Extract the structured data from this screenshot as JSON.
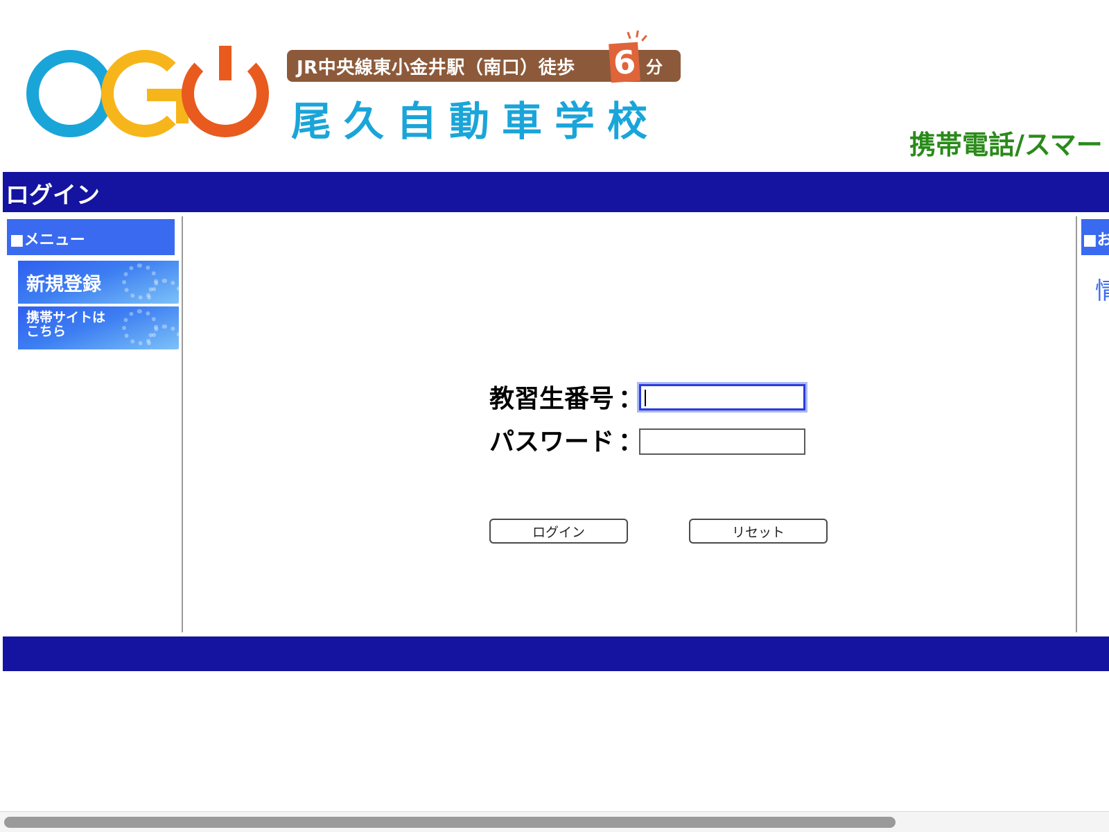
{
  "header": {
    "logo_alt": "OGO",
    "access": "JR中央線東小金井駅（南口）徒歩",
    "access_minutes": "6",
    "access_unit": "分",
    "school_name": "尾久自動車学校",
    "mobile_banner": "携帯電話/スマートフ"
  },
  "title": "ログイン",
  "sidebar": {
    "heading": "■メニュー",
    "items": [
      {
        "label": "新規登録"
      },
      {
        "label_lines": [
          "携帯サイトは",
          "こちら"
        ]
      }
    ]
  },
  "form": {
    "student_label": "教習生番号",
    "password_label": "パスワード",
    "colon": "：",
    "student_value": "",
    "password_value": "",
    "login_button": "ログイン",
    "reset_button": "リセット"
  },
  "right_column": {
    "heading": "■お",
    "link": "情"
  },
  "colors": {
    "brand_navy": "#1414a0",
    "menu_blue": "#3a6af0",
    "logo_blue": "#1aa5d9",
    "logo_yellow": "#f6b51a",
    "logo_orange": "#e85a1e",
    "banner_brown": "#8c5a3a",
    "mobile_green": "#2a8a1a"
  },
  "scrollbar": {
    "position_fraction": 0.0,
    "visible_fraction": 0.81
  }
}
